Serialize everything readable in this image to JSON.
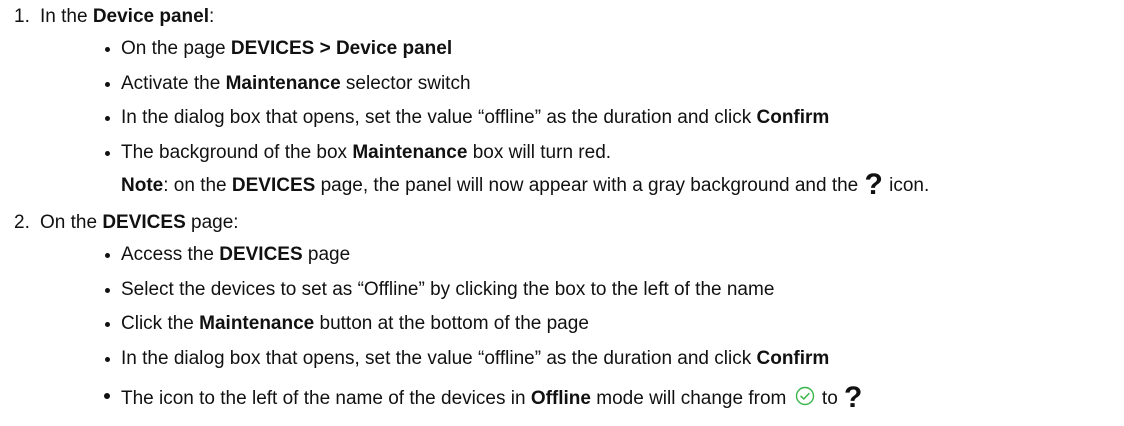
{
  "steps": [
    {
      "number": "1.",
      "prefix": "In the ",
      "bold": "Device panel",
      "suffix": ":",
      "bullets": [
        {
          "a": "On the page ",
          "b": "DEVICES > Device panel",
          "c": ""
        },
        {
          "a": "Activate the ",
          "b": "Maintenance",
          "c": " selector switch"
        },
        {
          "a": "In the dialog box that opens, set the value “offline” as the duration and click ",
          "b": "Confirm",
          "c": ""
        },
        {
          "a": "The background of the box ",
          "b": "Maintenance",
          "c": " box will turn red."
        }
      ],
      "note": {
        "label": "Note",
        "t1": ": on the ",
        "b1": "DEVICES",
        "t2": " page, the panel will now appear with a gray background and the ",
        "icon": "question-mark-icon",
        "glyph": "?",
        "t3": " icon."
      }
    },
    {
      "number": "2.",
      "prefix": "On the ",
      "bold": "DEVICES",
      "suffix": " page:",
      "bullets": [
        {
          "a": "Access the ",
          "b": "DEVICES",
          "c": " page"
        },
        {
          "a": "Select the devices to set as “Offline” by clicking the box to the left of the name",
          "b": "",
          "c": ""
        },
        {
          "a": "Click the ",
          "b": "Maintenance",
          "c": " button at the bottom of the page"
        },
        {
          "a": "In the dialog box that opens, set the value “offline” as the duration and click ",
          "b": "Confirm",
          "c": ""
        }
      ],
      "last_bullet": {
        "t1": "The icon to the left of the name of the devices in ",
        "b1": "Offline",
        "t2": " mode will change from ",
        "icon_from": "check-circle-icon",
        "t3": " to ",
        "icon_to": "question-mark-icon",
        "glyph": "?"
      }
    }
  ],
  "colors": {
    "text": "#111111",
    "check_icon": "#39b54a"
  }
}
